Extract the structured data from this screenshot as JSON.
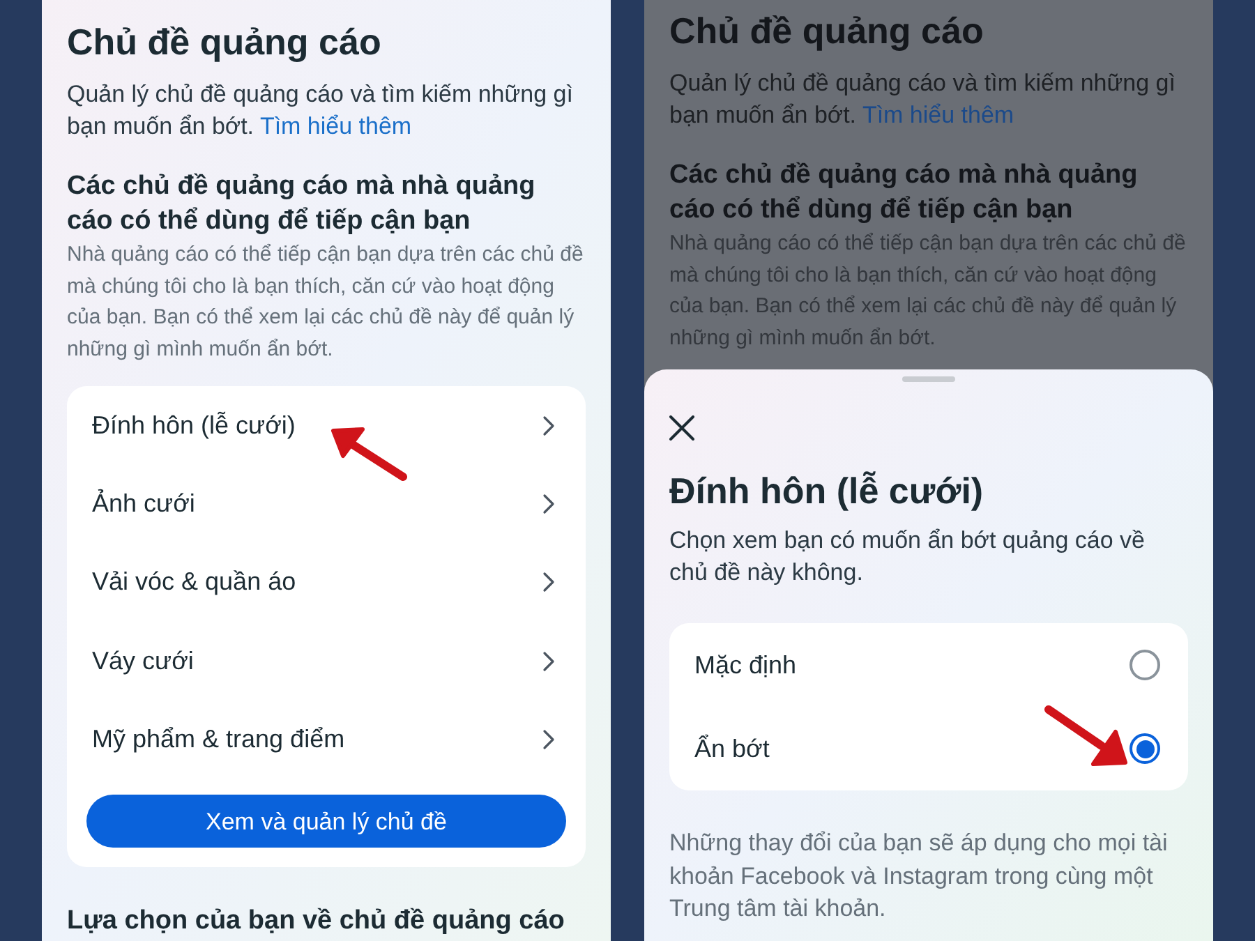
{
  "left_screen": {
    "title": "Chủ đề quảng cáo",
    "description": "Quản lý chủ đề quảng cáo và tìm kiếm những gì bạn muốn ẩn bớt.",
    "link": "Tìm hiểu thêm",
    "section_heading": "Các chủ đề quảng cáo mà nhà quảng cáo có thể dùng để tiếp cận bạn",
    "section_description": "Nhà quảng cáo có thể tiếp cận bạn dựa trên các chủ đề mà chúng tôi cho là bạn thích, căn cứ vào hoạt động của bạn. Bạn có thể xem lại các chủ đề này để quản lý những gì mình muốn ẩn bớt.",
    "topics": [
      {
        "label": "Đính hôn (lễ cưới)"
      },
      {
        "label": "Ảnh cưới"
      },
      {
        "label": "Vải vóc & quần áo"
      },
      {
        "label": "Váy cưới"
      },
      {
        "label": "Mỹ phẩm & trang điểm"
      }
    ],
    "manage_button": "Xem và quản lý chủ đề",
    "next_heading": "Lựa chọn của bạn về chủ đề quảng cáo"
  },
  "right_screen": {
    "background": {
      "title": "Chủ đề quảng cáo",
      "description": "Quản lý chủ đề quảng cáo và tìm kiếm những gì bạn muốn ẩn bớt.",
      "link": "Tìm hiểu thêm",
      "section_heading": "Các chủ đề quảng cáo mà nhà quảng cáo có thể dùng để tiếp cận bạn",
      "section_description": "Nhà quảng cáo có thể tiếp cận bạn dựa trên các chủ đề mà chúng tôi cho là bạn thích, căn cứ vào hoạt động của bạn. Bạn có thể xem lại các chủ đề này để quản lý những gì mình muốn ẩn bớt."
    },
    "sheet": {
      "title": "Đính hôn (lễ cưới)",
      "description": "Chọn xem bạn có muốn ẩn bớt quảng cáo về chủ đề này không.",
      "options": [
        {
          "label": "Mặc định",
          "selected": false
        },
        {
          "label": "Ẩn bớt",
          "selected": true
        }
      ],
      "footnote": "Những thay đổi của bạn sẽ áp dụng cho mọi tài khoản Facebook và Instagram trong cùng một Trung tâm tài khoản."
    }
  }
}
